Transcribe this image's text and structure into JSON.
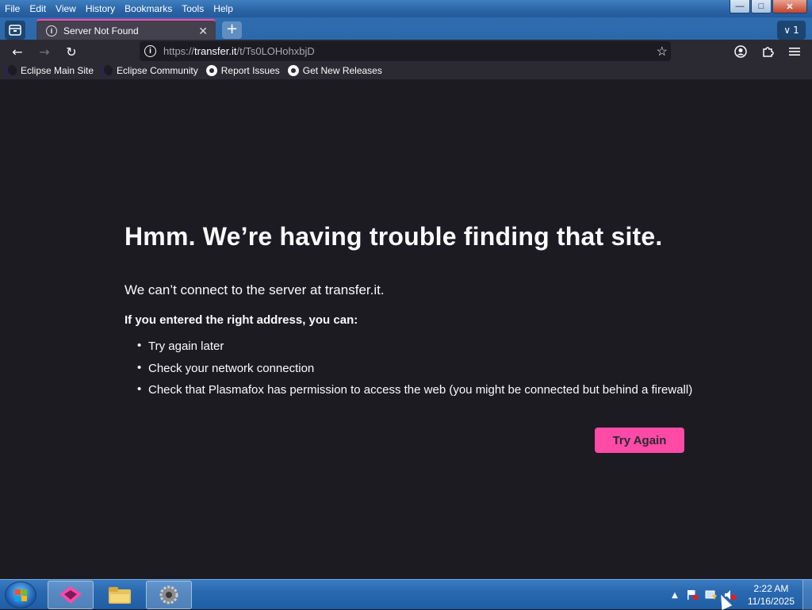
{
  "menubar": {
    "items": [
      "File",
      "Edit",
      "View",
      "History",
      "Bookmarks",
      "Tools",
      "Help"
    ],
    "controls": {
      "minimize": "—",
      "maximize": "□",
      "close": "✕"
    }
  },
  "tabs": {
    "active_title": "Server Not Found",
    "close_glyph": "✕",
    "new_tab_glyph": "+",
    "tab_count": "1",
    "tab_count_glyph": "∨"
  },
  "navbar": {
    "back_glyph": "←",
    "forward_glyph": "→",
    "reload_glyph": "↻",
    "url_scheme": "https://",
    "url_host": "transfer.it",
    "url_path": "/t/Ts0LOHohxbjD",
    "star_glyph": "☆",
    "account_glyph": "◎",
    "extensions_glyph": "❖",
    "menu_glyph": "≡"
  },
  "bookmarks": [
    {
      "label": "Eclipse Main Site",
      "icon": "eclipse-icon"
    },
    {
      "label": "Eclipse Community",
      "icon": "eclipse-icon"
    },
    {
      "label": "Report Issues",
      "icon": "github-icon"
    },
    {
      "label": "Get New Releases",
      "icon": "github-icon"
    }
  ],
  "error": {
    "title": "Hmm. We’re having trouble finding that site.",
    "description": "We can’t connect to the server at transfer.it.",
    "subheading": "If you entered the right address, you can:",
    "suggestions": [
      "Try again later",
      "Check your network connection",
      "Check that Plasmafox has permission to access the web (you might be connected but behind a firewall)"
    ],
    "button_label": "Try Again"
  },
  "taskbar": {
    "time": "2:22 AM",
    "date": "11/16/2025",
    "tray_arrow": "▲"
  },
  "colors": {
    "accent": "#ff4aa6",
    "page_background": "#1c1b22",
    "toolbar": "#2b2a33"
  }
}
